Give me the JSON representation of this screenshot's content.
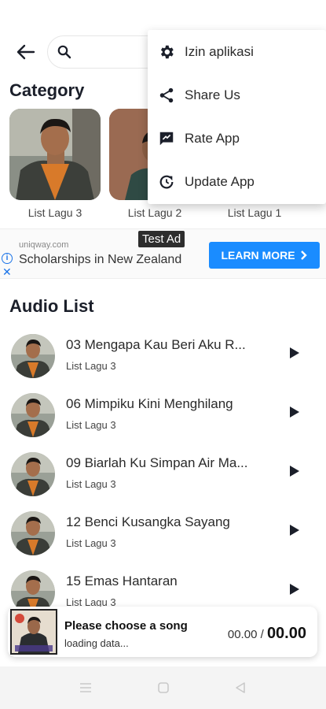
{
  "header": {
    "search_placeholder": ""
  },
  "menu": {
    "items": [
      {
        "label": "Izin aplikasi",
        "icon": "gear-icon"
      },
      {
        "label": "Share Us",
        "icon": "share-icon"
      },
      {
        "label": "Rate App",
        "icon": "rate-icon"
      },
      {
        "label": "Update App",
        "icon": "update-icon"
      }
    ]
  },
  "category": {
    "title": "Category",
    "items": [
      {
        "label": "List Lagu 3"
      },
      {
        "label": "List Lagu 2"
      },
      {
        "label": "List Lagu 1"
      }
    ]
  },
  "ad": {
    "tag": "Test Ad",
    "domain": "uniqway.com",
    "text": "Scholarships in New Zealand",
    "cta": "LEARN MORE",
    "cta_color": "#1a8cff"
  },
  "audio": {
    "title": "Audio List",
    "songs": [
      {
        "title": "03 Mengapa Kau Beri Aku R...",
        "list": "List Lagu 3"
      },
      {
        "title": "06 Mimpiku Kini Menghilang",
        "list": "List Lagu 3"
      },
      {
        "title": "09 Biarlah Ku Simpan Air Ma...",
        "list": "List Lagu 3"
      },
      {
        "title": "12 Benci Kusangka Sayang",
        "list": "List Lagu 3"
      },
      {
        "title": "15 Emas Hantaran",
        "list": "List Lagu 3"
      }
    ]
  },
  "player": {
    "title": "Please choose a song",
    "status": "loading data...",
    "current": "00.00",
    "separator": "/",
    "duration": "00.00"
  }
}
